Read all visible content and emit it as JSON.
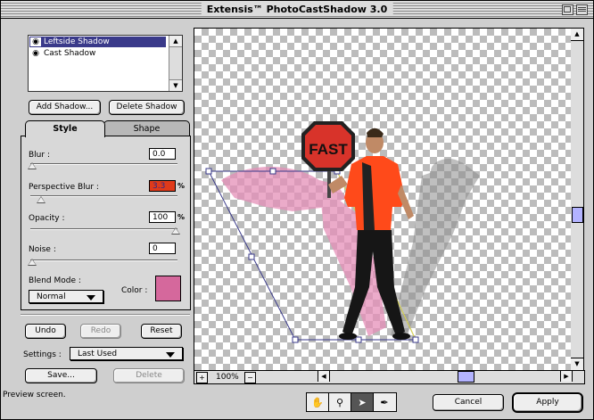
{
  "window": {
    "title": "Extensis™ PhotoCastShadow 3.0"
  },
  "shadows": {
    "items": [
      {
        "label": "Leftside Shadow",
        "selected": true
      },
      {
        "label": "Cast Shadow",
        "selected": false
      }
    ],
    "add_label": "Add Shadow...",
    "delete_label": "Delete Shadow"
  },
  "tabs": {
    "style": "Style",
    "shape": "Shape",
    "active": "Style"
  },
  "style": {
    "blur": {
      "label": "Blur :",
      "value": "0.0"
    },
    "perspective_blur": {
      "label": "Perspective Blur :",
      "value": "3.3",
      "unit": "%"
    },
    "opacity": {
      "label": "Opacity :",
      "value": "100",
      "unit": "%"
    },
    "noise": {
      "label": "Noise :",
      "value": "0"
    },
    "blend_mode": {
      "label": "Blend Mode :",
      "value": "Normal"
    },
    "color": {
      "label": "Color :",
      "hex": "#d5689c"
    }
  },
  "actions": {
    "undo": "Undo",
    "redo": "Redo",
    "reset": "Reset"
  },
  "settings": {
    "label": "Settings :",
    "value": "Last Used",
    "save": "Save...",
    "delete": "Delete"
  },
  "canvas": {
    "zoom": "100%",
    "sign_text": "FAST"
  },
  "status": "Preview screen.",
  "footer": {
    "cancel": "Cancel",
    "apply": "Apply"
  },
  "colors": {
    "selection": "#3a3a8a",
    "shadow": "#e58fb8",
    "bounding_box": "#3a3a8a",
    "vest": "#ff4a1a"
  }
}
